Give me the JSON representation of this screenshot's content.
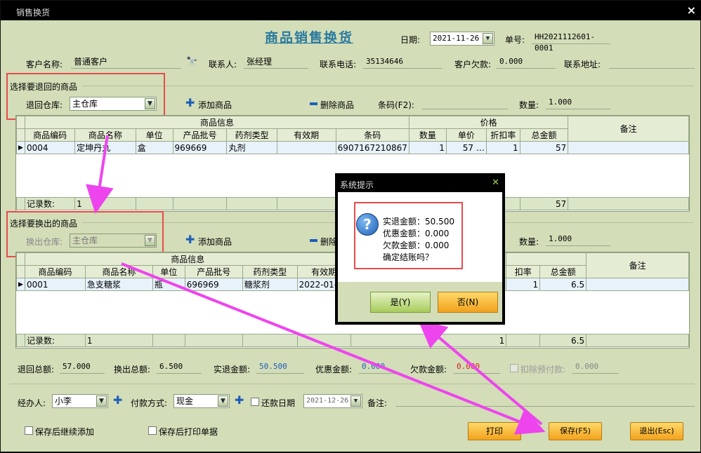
{
  "window": {
    "title": "销售换货",
    "close": "×"
  },
  "header": {
    "title": "商品销售换货",
    "date_label": "日期:",
    "date_value": "2021-11-26",
    "order_label": "单号:",
    "order_value": "HH2021112601-0001"
  },
  "customer": {
    "name_label": "客户名称:",
    "name_value": "普通客户",
    "contact_label": "联系人:",
    "contact_value": "张经理",
    "phone_label": "联系电话:",
    "phone_value": "35134646",
    "debt_label": "客户欠款:",
    "debt_value": "0.000",
    "address_label": "联系地址:",
    "address_value": ""
  },
  "return_section": {
    "title": "选择要退回的商品",
    "warehouse_label": "退回仓库:",
    "warehouse_value": "主仓库",
    "add_label": "添加商品",
    "delete_label": "删除商品",
    "barcode_label": "条码(F2):",
    "barcode_value": "",
    "qty_label": "数量:",
    "qty_value": "1.000"
  },
  "return_table": {
    "group_headers": {
      "info": "商品信息",
      "price": "价格",
      "remark": "备注"
    },
    "columns": [
      "商品编码",
      "商品名称",
      "单位",
      "产品批号",
      "药剂类型",
      "有效期",
      "条码",
      "数量",
      "单价",
      "折扣率",
      "总金额"
    ],
    "rows": [
      {
        "code": "0004",
        "name": "定坤丹丸",
        "unit": "盒",
        "batch": "969669",
        "type": "丸剂",
        "expiry": "",
        "barcode": "6907167210867",
        "qty": "1",
        "price": "57 …",
        "discount": "1",
        "total": "57"
      }
    ],
    "footer": {
      "label": "记录数:",
      "count": "1",
      "total": "57"
    }
  },
  "exchange_section": {
    "title": "选择要换出的商品",
    "warehouse_label": "换出仓库:",
    "warehouse_value": "主仓库",
    "add_label": "添加商品",
    "delete_label": "删除",
    "qty_label": "数量:",
    "qty_value": "1.000"
  },
  "exchange_table": {
    "group_headers": {
      "info": "商品信息",
      "remark": "备注"
    },
    "columns": [
      "商品编码",
      "商品名称",
      "单位",
      "产品批号",
      "药剂类型",
      "有效期",
      "扣率",
      "总金额"
    ],
    "rows": [
      {
        "code": "0001",
        "name": "急支糖浆",
        "unit": "瓶",
        "batch": "696969",
        "type": "糖浆剂",
        "expiry": "2022-01-",
        "discount": "1",
        "total": "6.5"
      }
    ],
    "footer": {
      "label": "记录数:",
      "count": "1",
      "qty": "1",
      "total": "6.5"
    }
  },
  "totals": {
    "return_label": "退回总额:",
    "return_value": "57.000",
    "exchange_label": "换出总额:",
    "exchange_value": "6.500",
    "actual_label": "实退金额:",
    "actual_value": "50.500",
    "discount_label": "优惠金额:",
    "discount_value": "0.000",
    "owed_label": "欠款金额:",
    "owed_value": "0.000",
    "deduct_label": "扣除预付款:",
    "deduct_value": "0.000"
  },
  "footer_form": {
    "handler_label": "经办人:",
    "handler_value": "小李",
    "payment_label": "付款方式:",
    "payment_value": "现金",
    "repay_label": "还款日期",
    "repay_value": "2021-12-26",
    "remark_label": "备注:",
    "remark_value": ""
  },
  "options": {
    "keep_adding": "保存后继续添加",
    "print_after": "保存后打印单据"
  },
  "buttons": {
    "print": "打印",
    "save": "保存(F5)",
    "exit": "退出(Esc)"
  },
  "dialog": {
    "title": "系统提示",
    "close": "✕",
    "icon": "?",
    "line1": "实退金额：50.500",
    "line2": "优惠金额：0.000",
    "line3": "欠款金额：0.000",
    "line4": "确定结账吗？",
    "yes": "是(Y)",
    "no": "否(N)"
  },
  "colors": {
    "background": "#d3ddb8",
    "accent": "#2a7a9e",
    "annotation": "#e84b4b",
    "arrow": "#ee44ee"
  }
}
